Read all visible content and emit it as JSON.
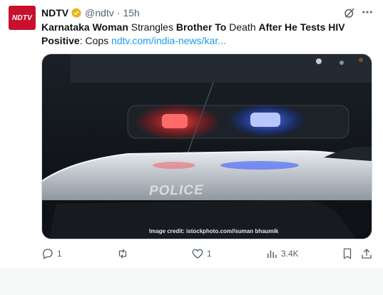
{
  "tweet": {
    "avatar_text": "NDTV",
    "author_name": "NDTV",
    "handle": "@ndtv",
    "separator": "·",
    "time": "15h",
    "text_parts": {
      "p1": "Karnataka Woman",
      "p2": " Strangles ",
      "p3": "Brother To",
      "p4": " Death ",
      "p5": "After He Tests HIV Positive",
      "p6": ": Cops ",
      "link": "ndtv.com/india-news/kar..."
    },
    "image": {
      "overlay_text": "POLICE",
      "credit": "Image credit: istockphoto.com//suman bhaumik"
    },
    "actions": {
      "reply_count": "1",
      "retweet_count": "",
      "like_count": "1",
      "view_count": "3.4K"
    },
    "colors": {
      "brand": "#c8102e",
      "link": "#1d9bf0",
      "muted": "#536471",
      "badge": "#e2b719"
    }
  }
}
